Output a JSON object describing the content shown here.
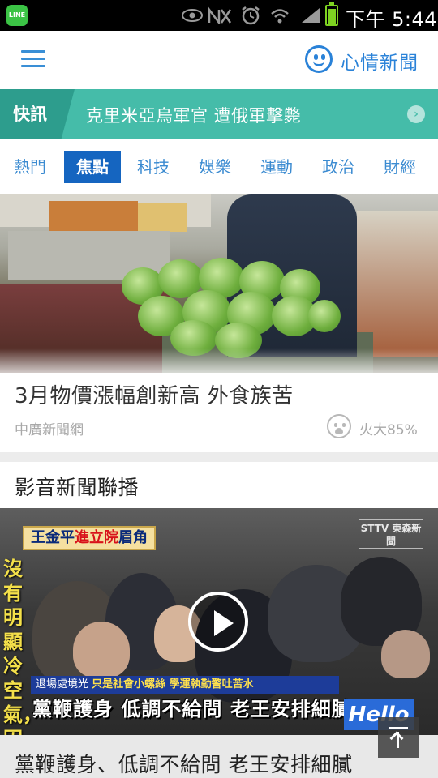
{
  "status_bar": {
    "app_badge": "LINE",
    "time": "下午 5:44",
    "icons": [
      "line-app-icon",
      "eye-icon",
      "no-signal-icon",
      "alarm-icon",
      "wifi-icon",
      "cell-signal-icon",
      "battery-icon"
    ]
  },
  "header": {
    "menu_icon": "hamburger-menu-icon",
    "brand_icon": "smiley-icon",
    "brand_name": "心情新聞",
    "brand_color": "#2a82d8"
  },
  "ticker": {
    "label": "快訊",
    "headline": "克里米亞烏軍官 遭俄軍擊斃",
    "next_icon": "chevron-right-icon",
    "color": "#45bca9"
  },
  "tabs": [
    {
      "label": "熱門",
      "active": false
    },
    {
      "label": "焦點",
      "active": true
    },
    {
      "label": "科技",
      "active": false
    },
    {
      "label": "娛樂",
      "active": false
    },
    {
      "label": "運動",
      "active": false
    },
    {
      "label": "政治",
      "active": false
    },
    {
      "label": "財經",
      "active": false
    }
  ],
  "hero": {
    "title": "3月物價漲幅創新高 外食族苦",
    "source": "中廣新聞網",
    "mood_icon": "surprised-face-icon",
    "mood_text": "火大85%"
  },
  "video_section": {
    "heading": "影音新聞聯播",
    "banner_prefix": "王金平",
    "banner_highlight": "進立院",
    "banner_suffix": "眉角",
    "channel_logo": "STTV 東森新聞",
    "vertical_caption": "沒有明顯冷空氣，因",
    "ribbon_left": "退場處境光",
    "ribbon_right": "只是社會小螺絲 學運執勤警吐苦水",
    "subtitle": "黨鞭護身 低調不給問 老王安排細膩",
    "corner_badge": "Hello",
    "play_icon": "play-icon",
    "caption": "黨鞭護身、低調不給問 老王安排細膩"
  },
  "scroll_top_icon": "arrow-up-icon"
}
